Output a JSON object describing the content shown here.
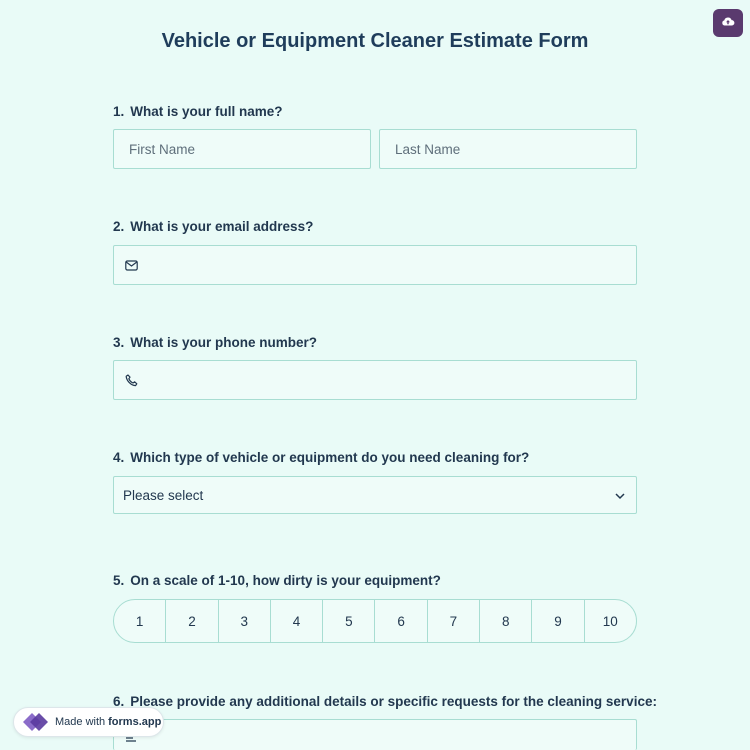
{
  "form": {
    "title": "Vehicle or Equipment Cleaner Estimate Form"
  },
  "questions": [
    {
      "number": "1.",
      "label": "What is your full name?"
    },
    {
      "number": "2.",
      "label": "What is your email address?"
    },
    {
      "number": "3.",
      "label": "What is your phone number?"
    },
    {
      "number": "4.",
      "label": "Which type of vehicle or equipment do you need cleaning for?"
    },
    {
      "number": "5.",
      "label": "On a scale of 1-10, how dirty is your equipment?"
    },
    {
      "number": "6.",
      "label": "Please provide any additional details or specific requests for the cleaning service:"
    }
  ],
  "name": {
    "first_placeholder": "First Name",
    "last_placeholder": "Last Name"
  },
  "email": {
    "icon": "envelope-icon"
  },
  "phone": {
    "icon": "phone-icon"
  },
  "vehicle_type": {
    "selected": "Please select",
    "icon": "chevron-down-icon"
  },
  "scale": {
    "options": [
      "1",
      "2",
      "3",
      "4",
      "5",
      "6",
      "7",
      "8",
      "9",
      "10"
    ]
  },
  "details": {
    "icon": "text-lines-icon"
  },
  "badge": {
    "prefix": "Made with",
    "brand": "forms.app"
  },
  "toolbar": {
    "save_icon": "cloud-upload-icon"
  },
  "colors": {
    "background": "#e9fbf7",
    "field_border": "#a8ddd2",
    "title": "#1f3d5b",
    "accent": "#5a3a6e"
  }
}
